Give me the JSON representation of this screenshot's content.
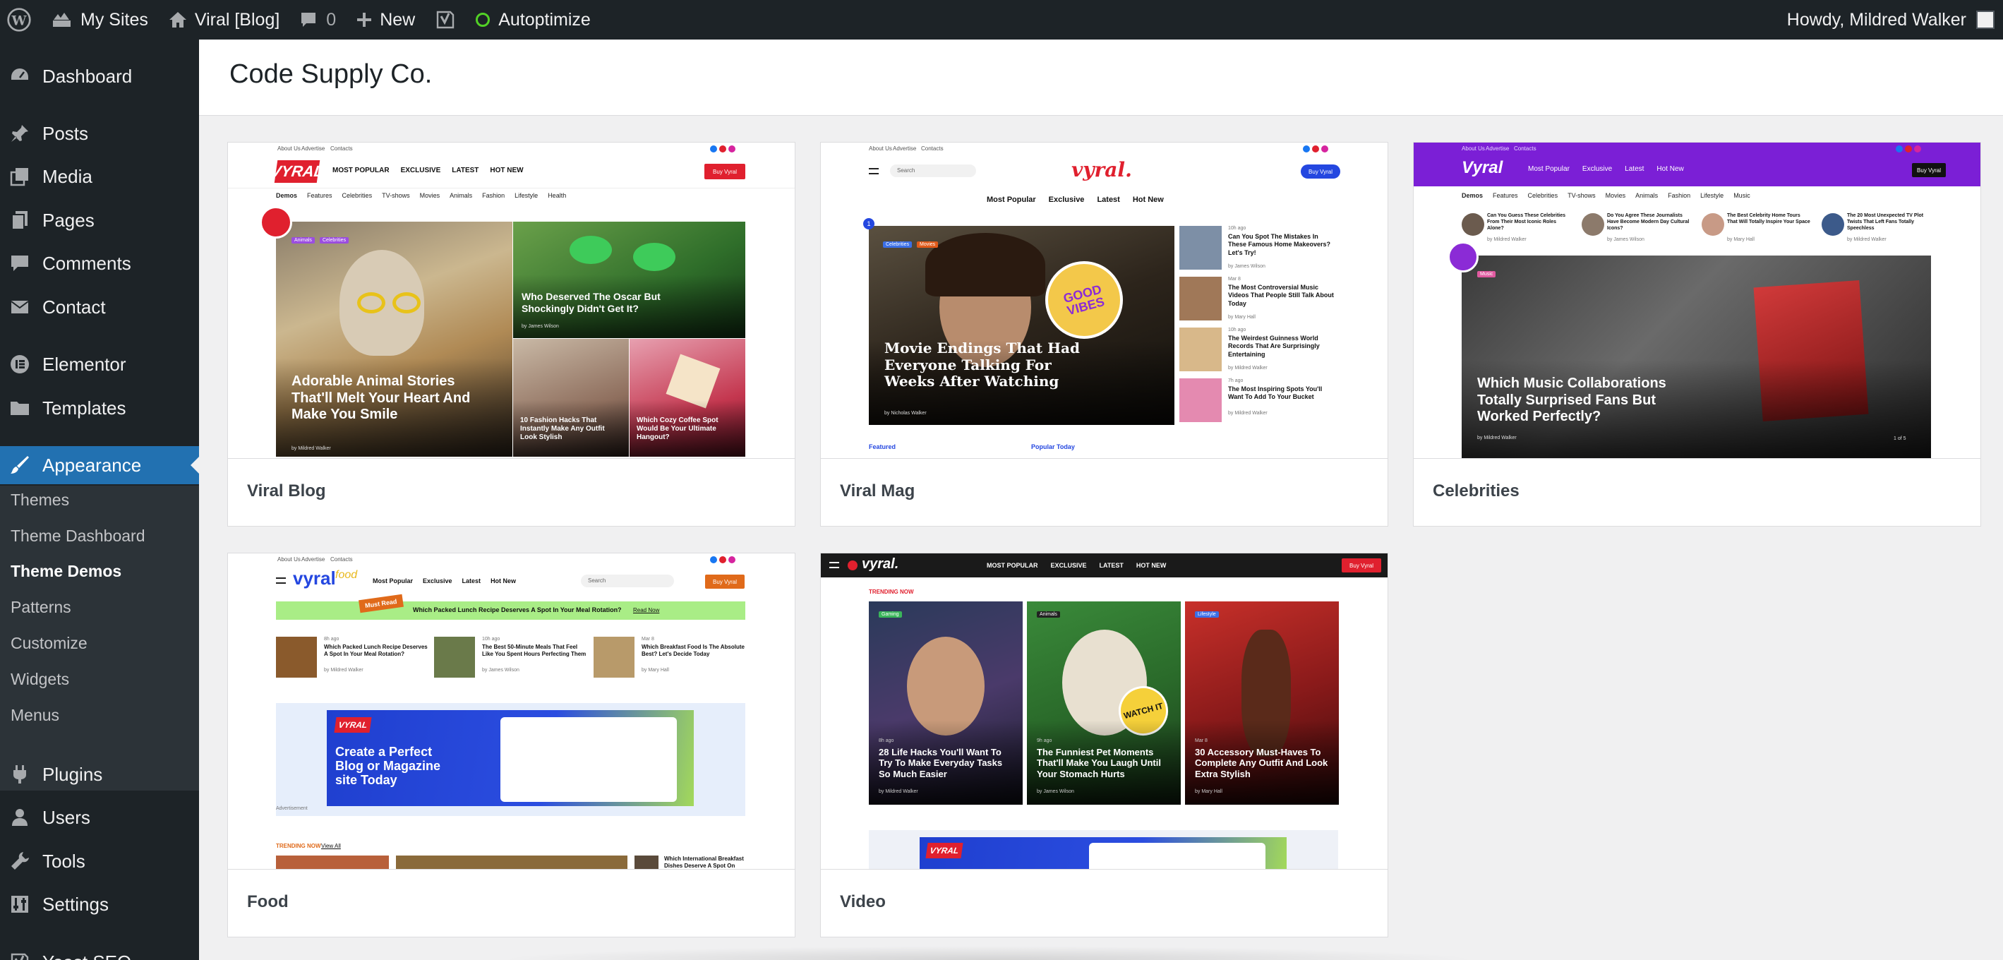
{
  "adminbar": {
    "my_sites": "My Sites",
    "site_name": "Viral [Blog]",
    "comments_count": "0",
    "new_label": "New",
    "autoptimize": "Autoptimize",
    "howdy": "Howdy, Mildred Walker"
  },
  "sidebar": {
    "items": {
      "dashboard": "Dashboard",
      "posts": "Posts",
      "media": "Media",
      "pages": "Pages",
      "comments": "Comments",
      "contact": "Contact",
      "elementor": "Elementor",
      "templates": "Templates",
      "appearance": "Appearance",
      "plugins": "Plugins",
      "users": "Users",
      "tools": "Tools",
      "settings": "Settings",
      "yoast": "Yoast SEO"
    },
    "submenu": {
      "themes": "Themes",
      "theme_dashboard": "Theme Dashboard",
      "theme_demos": "Theme Demos",
      "patterns": "Patterns",
      "customize": "Customize",
      "widgets": "Widgets",
      "menus": "Menus"
    }
  },
  "page": {
    "title": "Code Supply Co."
  },
  "demos": [
    {
      "name": "Viral Blog",
      "shot": {
        "top_links": [
          "About Us",
          "Advertise",
          "Contacts"
        ],
        "logo": "VYRAL",
        "nav": [
          "MOST POPULAR",
          "EXCLUSIVE",
          "LATEST",
          "HOT NEW"
        ],
        "buy": "Buy Vyral",
        "cats": [
          "Demos",
          "Features",
          "Celebrities",
          "TV-shows",
          "Movies",
          "Animals",
          "Fashion",
          "Lifestyle",
          "Health"
        ],
        "tags": [
          "Animals",
          "Celebrities"
        ],
        "main_headline": "Adorable Animal Stories That'll Melt Your Heart And Make You Smile",
        "main_meta": "by Mildred Walker",
        "side_headline": "Who Deserved The Oscar But Shockingly Didn't Get It?",
        "side_meta": "by James Wilson",
        "small1": "10 Fashion Hacks That Instantly Make Any Outfit Look Stylish",
        "small2": "Which Cozy Coffee Spot Would Be Your Ultimate Hangout?"
      }
    },
    {
      "name": "Viral Mag",
      "shot": {
        "top_links": [
          "About Us",
          "Advertise",
          "Contacts"
        ],
        "search": "Search",
        "logo": "vyral.",
        "buy": "Buy Vyral",
        "nav": [
          "Most Popular",
          "Exclusive",
          "Latest",
          "Hot New"
        ],
        "tags": [
          "Celebrities",
          "Movies"
        ],
        "main_headline": "Movie Endings That Had Everyone Talking For Weeks After Watching",
        "main_meta": "by Nicholas Walker",
        "sticker": "GOOD VIBES",
        "list": [
          {
            "title": "Can You Spot The Mistakes In These Famous Home Makeovers? Let's Try!",
            "meta": "by James Wilson",
            "time": "10h ago"
          },
          {
            "title": "The Most Controversial Music Videos That People Still Talk About Today",
            "meta": "by Mary Hall",
            "time": "Mar 8"
          },
          {
            "title": "The Weirdest Guinness World Records That Are Surprisingly Entertaining",
            "meta": "by Mildred Walker",
            "time": "10h ago"
          },
          {
            "title": "The Most Inspiring Spots You'll Want To Add To Your Bucket",
            "meta": "by Mildred Walker",
            "time": "7h ago"
          }
        ],
        "featured": "Featured",
        "popular": "Popular Today"
      }
    },
    {
      "name": "Celebrities",
      "shot": {
        "top_links": [
          "About Us",
          "Advertise",
          "Contacts"
        ],
        "logo": "Vyral",
        "nav": [
          "Most Popular",
          "Exclusive",
          "Latest",
          "Hot New"
        ],
        "buy": "Buy Vyral",
        "cats": [
          "Demos",
          "Features",
          "Celebrities",
          "TV-shows",
          "Movies",
          "Animals",
          "Fashion",
          "Lifestyle",
          "Music"
        ],
        "stories": [
          {
            "title": "Can You Guess These Celebrities From Their Most Iconic Roles Alone?",
            "meta": "by Mildred Walker"
          },
          {
            "title": "Do You Agree These Journalists Have Become Modern Day Cultural Icons?",
            "meta": "by James Wilson"
          },
          {
            "title": "The Best Celebrity Home Tours That Will Totally Inspire Your Space",
            "meta": "by Mary Hall"
          },
          {
            "title": "The 20 Most Unexpected TV Plot Twists That Left Fans Totally Speechless",
            "meta": "by Mildred Walker"
          }
        ],
        "tag": "Music",
        "main_headline": "Which Music Collaborations Totally Surprised Fans But Worked Perfectly?",
        "main_meta": "by Mildred Walker",
        "pager": "1 of 5"
      }
    },
    {
      "name": "Food",
      "shot": {
        "top_links": [
          "About Us",
          "Advertise",
          "Contacts"
        ],
        "logo": "vyral",
        "logo_sub": "food",
        "nav": [
          "Most Popular",
          "Exclusive",
          "Latest",
          "Hot New"
        ],
        "search": "Search",
        "buy": "Buy Vyral",
        "must_read": "Must Read",
        "banner": "Which Packed Lunch Recipe Deserves A Spot In Your Meal Rotation?",
        "banner_link": "Read Now",
        "posts": [
          {
            "time": "8h ago",
            "title": "Which Packed Lunch Recipe Deserves A Spot In Your Meal Rotation?",
            "meta": "by Mildred Walker"
          },
          {
            "time": "10h ago",
            "title": "The Best 50-Minute Meals That Feel Like You Spent Hours Perfecting Them",
            "meta": "by James Wilson"
          },
          {
            "time": "Mar 8",
            "title": "Which Breakfast Food Is The Absolute Best? Let's Decide Today",
            "meta": "by Mary Hall"
          }
        ],
        "ad_logo": "VYRAL",
        "ad_text": "Create a Perfect Blog or Magazine site Today",
        "ad_label": "Advertisement",
        "trending": "TRENDING NOW",
        "view_all": "View All",
        "trend_item": "Which International Breakfast Dishes Deserve A Spot On Your"
      }
    },
    {
      "name": "Video",
      "shot": {
        "logo": "vyral.",
        "nav": [
          "MOST POPULAR",
          "EXCLUSIVE",
          "LATEST",
          "HOT NEW"
        ],
        "buy": "Buy Vyral",
        "trending": "TRENDING NOW",
        "cards": [
          {
            "tag": "Gaming",
            "time": "8h ago",
            "title": "28 Life Hacks You'll Want To Try To Make Everyday Tasks So Much Easier",
            "meta": "by Mildred Walker"
          },
          {
            "tag": "Animals",
            "time": "9h ago",
            "title": "The Funniest Pet Moments That'll Make You Laugh Until Your Stomach Hurts",
            "meta": "by James Wilson"
          },
          {
            "tag": "Lifestyle",
            "time": "Mar 8",
            "title": "30 Accessory Must-Haves To Complete Any Outfit And Look Extra Stylish",
            "meta": "by Mary Hall"
          }
        ],
        "sticker": "WATCH IT",
        "ad_logo": "VYRAL"
      }
    }
  ],
  "colors": {
    "admin_dark": "#1d2327",
    "accent": "#2271b1",
    "vyral_red": "#e0202e",
    "celeb_purple": "#7b1fd6"
  }
}
